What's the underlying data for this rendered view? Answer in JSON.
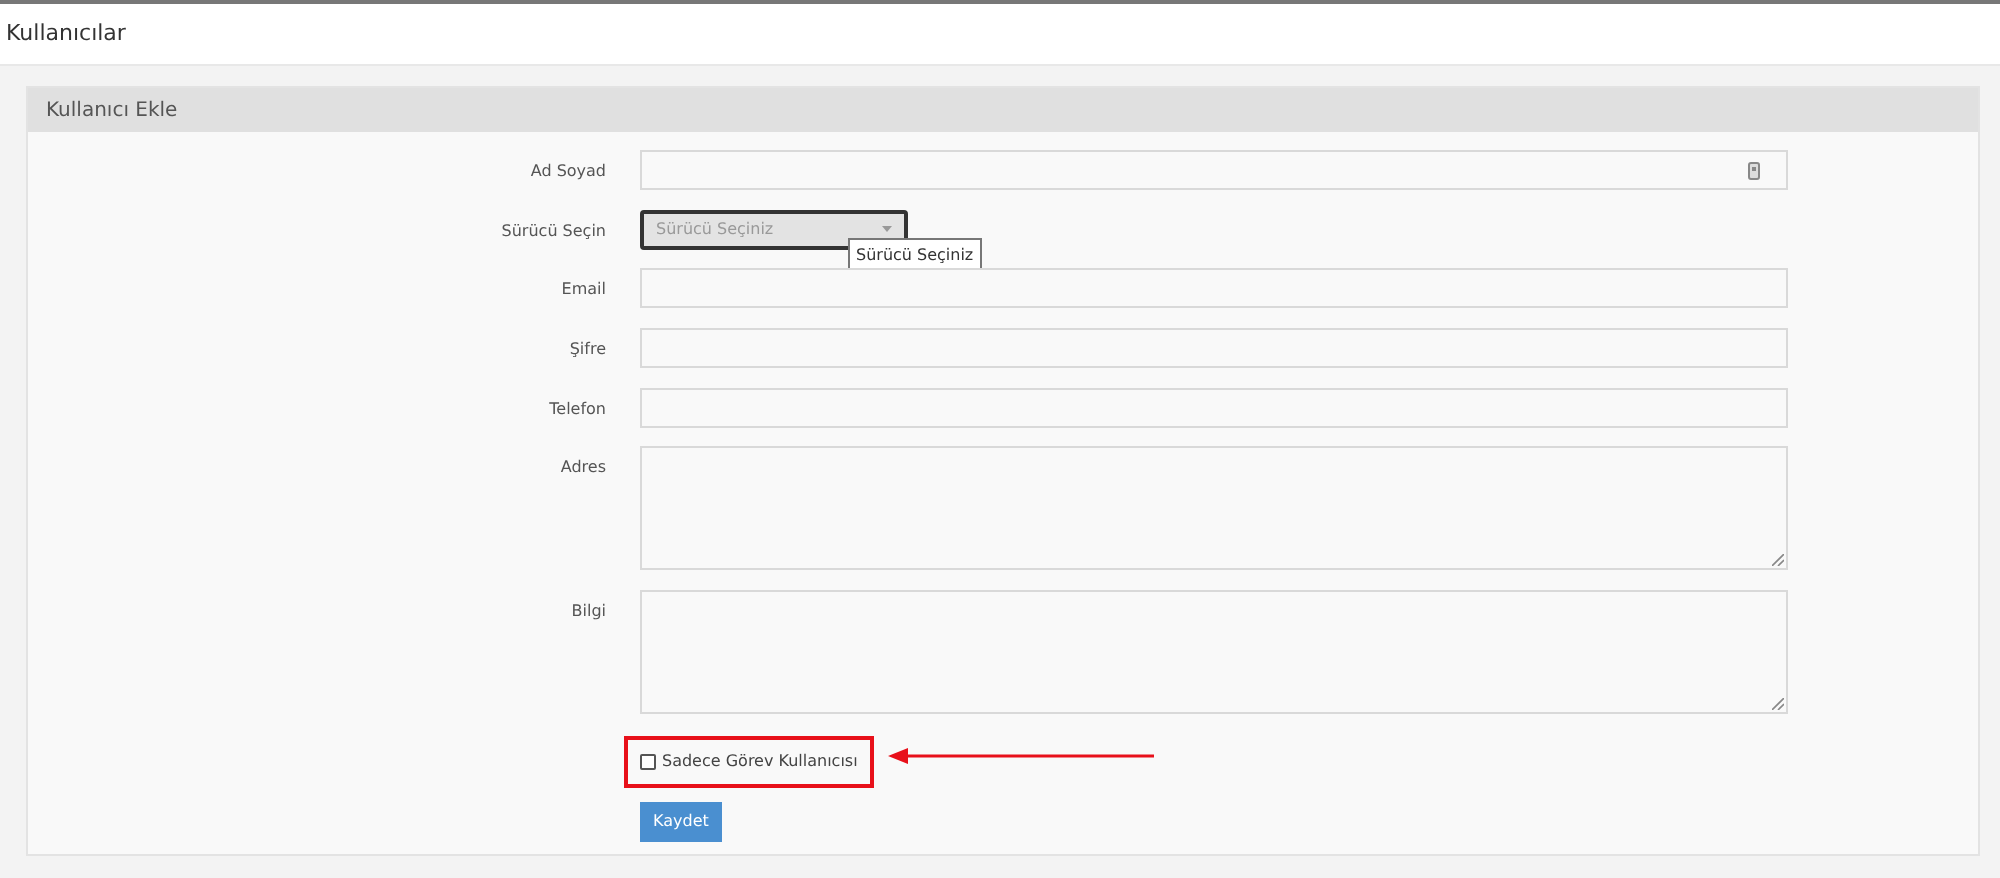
{
  "page_title": "Kullanıcılar",
  "panel": {
    "title": "Kullanıcı Ekle",
    "fields": [
      {
        "label": "Ad Soyad",
        "kind": "icon_input"
      },
      {
        "label": "Sürücü Seçin",
        "kind": "select",
        "value": "Sürücü Seçiniz",
        "tooltip": "Sürücü Seçiniz"
      },
      {
        "label": "Email",
        "kind": "input"
      },
      {
        "label": "Şifre",
        "kind": "input"
      },
      {
        "label": "Telefon",
        "kind": "input"
      },
      {
        "label": "Adres",
        "kind": "textarea"
      },
      {
        "label": "Bilgi",
        "kind": "textarea"
      }
    ],
    "checkbox": {
      "label": "Sadece Görev Kullanıcısı",
      "checked": false,
      "highlighted": true
    },
    "submit": "Kaydet"
  }
}
